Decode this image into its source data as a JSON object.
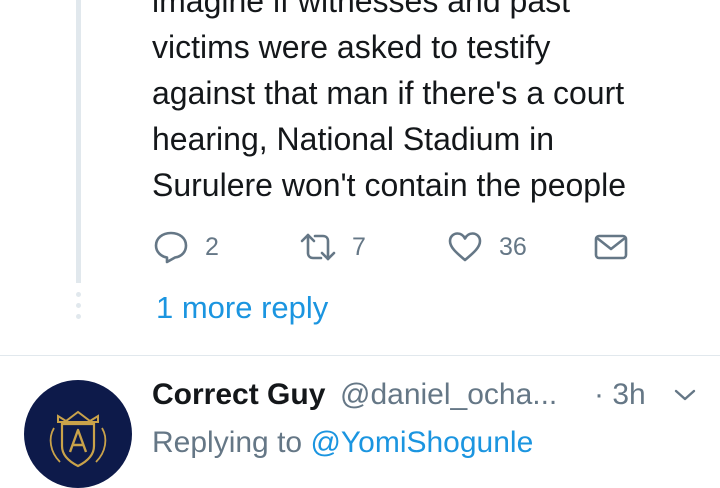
{
  "thread": {
    "tweet_lines": [
      "imagine if witnesses and past",
      "victims were asked to testify",
      "against that man if there's a court",
      "hearing, National Stadium in",
      "Surulere won't contain the people"
    ],
    "actions": {
      "reply_count": "2",
      "retweet_count": "7",
      "like_count": "36"
    },
    "more_reply_label": "1 more reply"
  },
  "reply": {
    "author_name": "Correct Guy",
    "handle": "@daniel_ocha...",
    "time": "· 3h",
    "replying_prefix": "Replying to",
    "replying_mention": "@YomiShogunle"
  },
  "colors": {
    "link": "#1b95e0",
    "secondary_text": "#657786",
    "icon": "#657786",
    "divider": "#e1e8ed",
    "avatar_bg": "#0d1a4a",
    "avatar_crest": "#c9a24a"
  },
  "icons": [
    "reply-icon",
    "retweet-icon",
    "like-icon",
    "direct-message-icon",
    "chevron-down-icon"
  ]
}
